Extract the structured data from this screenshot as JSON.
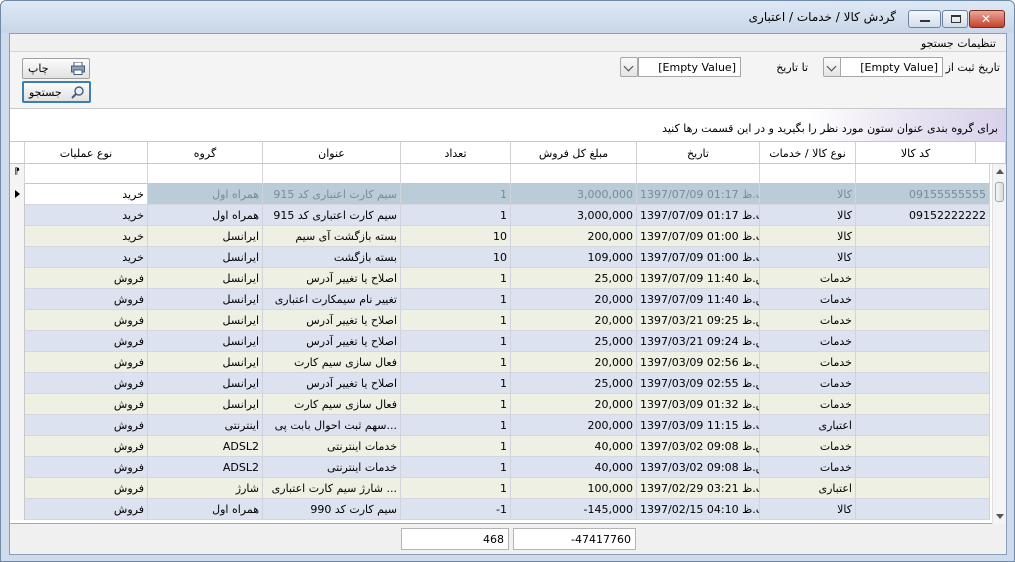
{
  "window": {
    "title": "گردش کالا / خدمات / اعتباری"
  },
  "search": {
    "header": "تنظیمات جستجو",
    "from_label": "تاریخ ثبت از",
    "from_value": "[Empty Value]",
    "to_label": "تا تاریخ",
    "to_value": "[Empty Value]",
    "print_label": "چاپ",
    "search_label": "جستجو"
  },
  "group_hint": "برای گروه بندی عنوان ستون مورد نظر را بگیرید و در این قسمت رها کنید",
  "grid": {
    "columns": [
      "کد کالا",
      "نوع کالا / خدمات",
      "تاریخ",
      "مبلغ کل فروش",
      "تعداد",
      "عنوان",
      "گروه",
      "نوع عملیات"
    ],
    "rows": [
      {
        "code": "09155555555",
        "type": "کالا",
        "date": "ب.ظ 01:17 1397/07/09",
        "amount": "3,000,000",
        "qty": "1",
        "title": "سیم کارت اعتباری کد 915",
        "group": "همراه اول",
        "op": "خرید"
      },
      {
        "code": "09152222222",
        "type": "کالا",
        "date": "ب.ظ 01:17 1397/07/09",
        "amount": "3,000,000",
        "qty": "1",
        "title": "سیم کارت اعتباری کد 915",
        "group": "همراه اول",
        "op": "خرید"
      },
      {
        "code": "",
        "type": "کالا",
        "date": "ب.ظ 01:00 1397/07/09",
        "amount": "200,000",
        "qty": "10",
        "title": "بسته بازگشت آی سیم",
        "group": "ایرانسل",
        "op": "خرید"
      },
      {
        "code": "",
        "type": "کالا",
        "date": "ب.ظ 01:00 1397/07/09",
        "amount": "109,000",
        "qty": "10",
        "title": "بسته بازگشت",
        "group": "ایرانسل",
        "op": "خرید"
      },
      {
        "code": "",
        "type": "خدمات",
        "date": "ق.ظ 11:40 1397/07/09",
        "amount": "25,000",
        "qty": "1",
        "title": "اصلاح یا تغییر آدرس",
        "group": "ایرانسل",
        "op": "فروش"
      },
      {
        "code": "",
        "type": "خدمات",
        "date": "ق.ظ 11:40 1397/07/09",
        "amount": "20,000",
        "qty": "1",
        "title": "تغییر نام سیمکارت اعتباری",
        "group": "ایرانسل",
        "op": "فروش"
      },
      {
        "code": "",
        "type": "خدمات",
        "date": "ق.ظ 09:25 1397/03/21",
        "amount": "20,000",
        "qty": "1",
        "title": "اصلاح یا تغییر آدرس",
        "group": "ایرانسل",
        "op": "فروش"
      },
      {
        "code": "",
        "type": "خدمات",
        "date": "ق.ظ 09:24 1397/03/21",
        "amount": "25,000",
        "qty": "1",
        "title": "اصلاح یا تغییر آدرس",
        "group": "ایرانسل",
        "op": "فروش"
      },
      {
        "code": "",
        "type": "خدمات",
        "date": "ق.ظ 02:56 1397/03/09",
        "amount": "20,000",
        "qty": "1",
        "title": "فعال سازی سیم کارت",
        "group": "ایرانسل",
        "op": "فروش"
      },
      {
        "code": "",
        "type": "خدمات",
        "date": "ق.ظ 02:55 1397/03/09",
        "amount": "25,000",
        "qty": "1",
        "title": "اصلاح یا تغییر آدرس",
        "group": "ایرانسل",
        "op": "فروش"
      },
      {
        "code": "",
        "type": "خدمات",
        "date": "ق.ظ 01:32 1397/03/09",
        "amount": "20,000",
        "qty": "1",
        "title": "فعال سازی سیم کارت",
        "group": "ایرانسل",
        "op": "فروش"
      },
      {
        "code": "",
        "type": "اعتباری",
        "date": "ب.ظ 11:15 1397/03/09",
        "amount": "200,000",
        "qty": "1",
        "title": "...سهم ثبت احوال بابت پی",
        "group": "اینترنتی",
        "op": "فروش"
      },
      {
        "code": "",
        "type": "خدمات",
        "date": "ق.ظ 09:08 1397/03/02",
        "amount": "40,000",
        "qty": "1",
        "title": "خدمات اینترنتی",
        "group": "ADSL2",
        "op": "فروش"
      },
      {
        "code": "",
        "type": "خدمات",
        "date": "ق.ظ 09:08 1397/03/02",
        "amount": "40,000",
        "qty": "1",
        "title": "خدمات اینترنتی",
        "group": "ADSL2",
        "op": "فروش"
      },
      {
        "code": "",
        "type": "اعتباری",
        "date": "ب.ظ 03:21 1397/02/29",
        "amount": "100,000",
        "qty": "1",
        "title": "... شارژ سیم کارت اعتباری",
        "group": "شارژ",
        "op": "فروش"
      },
      {
        "code": "",
        "type": "کالا",
        "date": "ب.ظ 04:10 1397/02/15",
        "amount": "-145,000",
        "qty": "-1",
        "title": "سیم کارت کد 990",
        "group": "همراه اول",
        "op": "فروش"
      }
    ],
    "selected_row": 0
  },
  "totals": {
    "amount": "-47417760",
    "qty": "468"
  },
  "icons": {
    "print": "printer-icon",
    "search": "magnifier-icon",
    "close": "close-icon",
    "maximize": "maximize-icon",
    "minimize": "minimize-icon"
  },
  "colors": {
    "row_a": "#eef0e4",
    "row_b": "#dde2f1",
    "selected": "#b9ccd8"
  }
}
